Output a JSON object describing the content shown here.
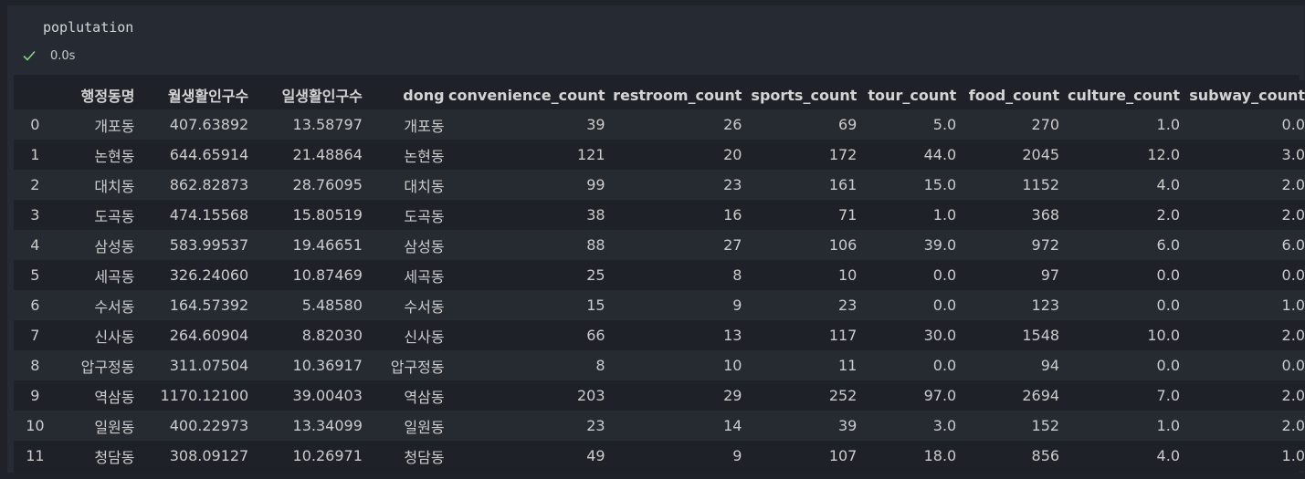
{
  "cell": {
    "code": "poplutation",
    "exec_time": "0.0s",
    "status_color": "#89d185"
  },
  "table": {
    "columns": [
      "행정동명",
      "월생활인구수",
      "일생활인구수",
      "dong",
      "convenience_count",
      "restroom_count",
      "sports_count",
      "tour_count",
      "food_count",
      "culture_count",
      "subway_count"
    ],
    "rows": [
      [
        "0",
        "개포동",
        "407.63892",
        "13.58797",
        "개포동",
        "39",
        "26",
        "69",
        "5.0",
        "270",
        "1.0",
        "0.0"
      ],
      [
        "1",
        "논현동",
        "644.65914",
        "21.48864",
        "논현동",
        "121",
        "20",
        "172",
        "44.0",
        "2045",
        "12.0",
        "3.0"
      ],
      [
        "2",
        "대치동",
        "862.82873",
        "28.76095",
        "대치동",
        "99",
        "23",
        "161",
        "15.0",
        "1152",
        "4.0",
        "2.0"
      ],
      [
        "3",
        "도곡동",
        "474.15568",
        "15.80519",
        "도곡동",
        "38",
        "16",
        "71",
        "1.0",
        "368",
        "2.0",
        "2.0"
      ],
      [
        "4",
        "삼성동",
        "583.99537",
        "19.46651",
        "삼성동",
        "88",
        "27",
        "106",
        "39.0",
        "972",
        "6.0",
        "6.0"
      ],
      [
        "5",
        "세곡동",
        "326.24060",
        "10.87469",
        "세곡동",
        "25",
        "8",
        "10",
        "0.0",
        "97",
        "0.0",
        "0.0"
      ],
      [
        "6",
        "수서동",
        "164.57392",
        "5.48580",
        "수서동",
        "15",
        "9",
        "23",
        "0.0",
        "123",
        "0.0",
        "1.0"
      ],
      [
        "7",
        "신사동",
        "264.60904",
        "8.82030",
        "신사동",
        "66",
        "13",
        "117",
        "30.0",
        "1548",
        "10.0",
        "2.0"
      ],
      [
        "8",
        "압구정동",
        "311.07504",
        "10.36917",
        "압구정동",
        "8",
        "10",
        "11",
        "0.0",
        "94",
        "0.0",
        "0.0"
      ],
      [
        "9",
        "역삼동",
        "1170.12100",
        "39.00403",
        "역삼동",
        "203",
        "29",
        "252",
        "97.0",
        "2694",
        "7.0",
        "2.0"
      ],
      [
        "10",
        "일원동",
        "400.22973",
        "13.34099",
        "일원동",
        "23",
        "14",
        "39",
        "3.0",
        "152",
        "1.0",
        "2.0"
      ],
      [
        "11",
        "청담동",
        "308.09127",
        "10.26971",
        "청담동",
        "49",
        "9",
        "107",
        "18.0",
        "856",
        "4.0",
        "1.0"
      ]
    ]
  }
}
